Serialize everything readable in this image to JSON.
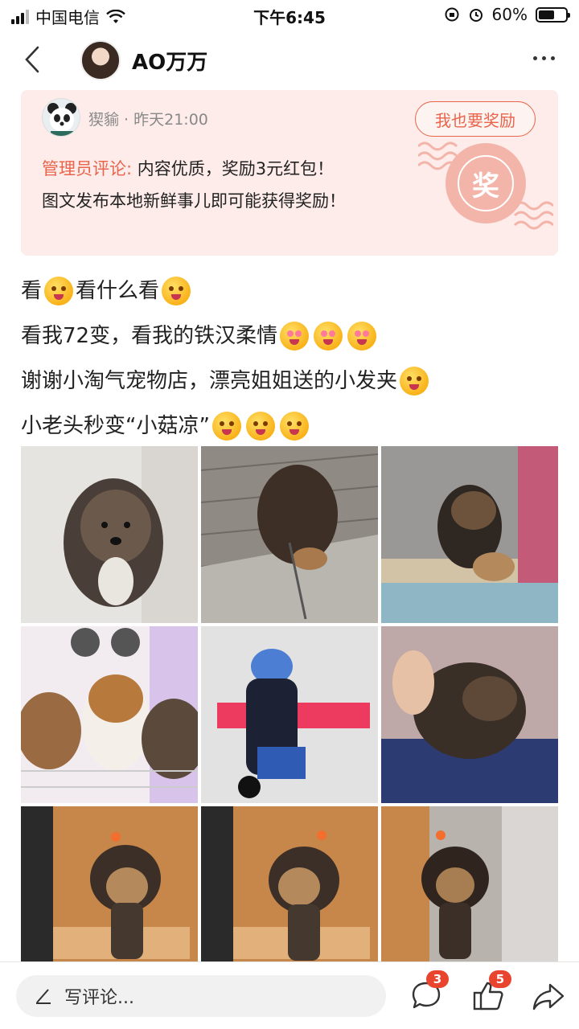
{
  "status_bar": {
    "carrier": "中国电信",
    "time": "下午6:45",
    "battery": "60%",
    "battery_level": 0.6
  },
  "nav": {
    "title": "AO万万"
  },
  "reward_card": {
    "admin_name": "猰貐 · 昨天21:00",
    "button_label": "我也要奖励",
    "comment_label": "管理员评论:",
    "comment_text": "内容优质，奖励3元红包！",
    "note": "图文发布本地新鲜事儿即可能获得奖励！",
    "stamp_char": "奖"
  },
  "post": {
    "lines": [
      [
        "看",
        "看什么看"
      ],
      [
        "看我72变，看我的铁汉柔情"
      ],
      [
        "谢谢小淘气宠物店，漂亮姐姐送的小发夹"
      ],
      [
        "小老头秒变“小菇凉”"
      ]
    ]
  },
  "bottom_bar": {
    "comment_placeholder": "写评论...",
    "comment_count": "3",
    "like_count": "5"
  },
  "colors": {
    "accent": "#e8644b",
    "reward_bg": "#fdece9",
    "badge": "#e8442e"
  }
}
